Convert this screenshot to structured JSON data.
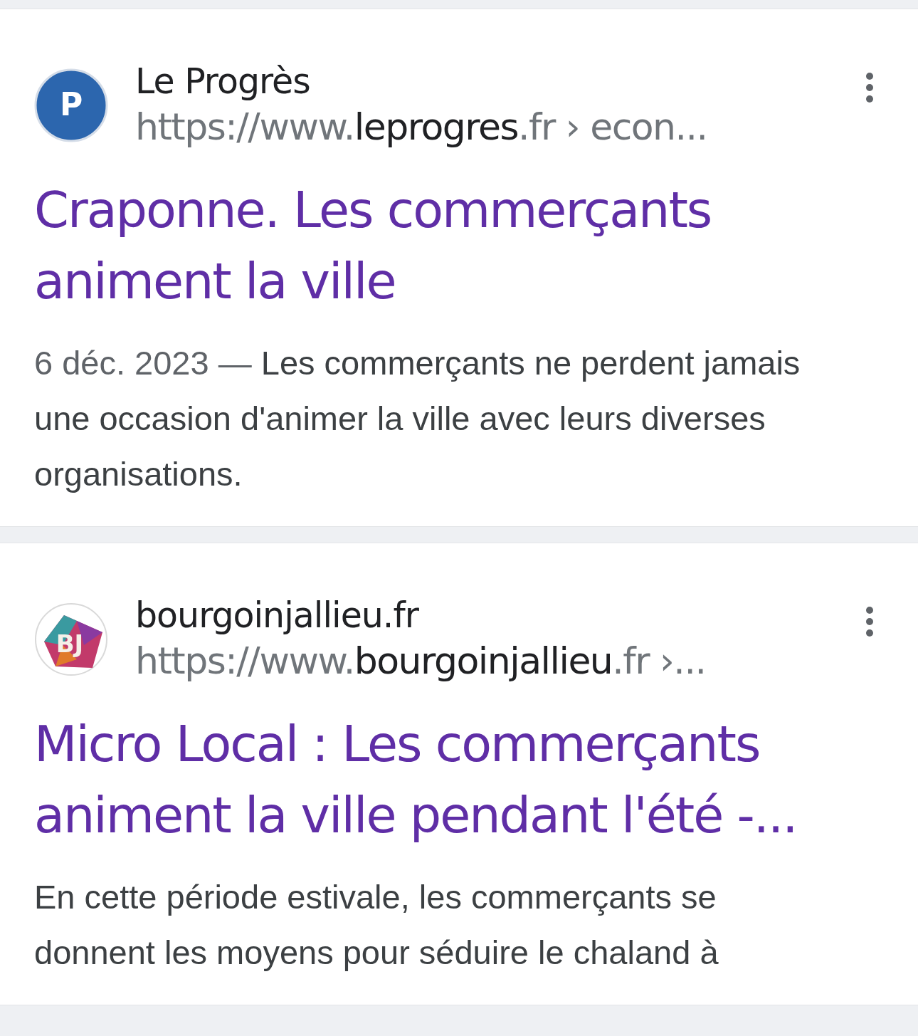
{
  "results": [
    {
      "source": "Le Progrès",
      "logo": {
        "kind": "letter",
        "text": "P"
      },
      "url_parts": [
        {
          "text": "https://www.",
          "strong": false
        },
        {
          "text": "leprogres",
          "strong": true
        },
        {
          "text": ".fr › econ...",
          "strong": false
        }
      ],
      "title": "Craponne. Les commerçants animent la ville",
      "date": "6 déc. 2023",
      "date_separator": "—",
      "snippet": "Les commerçants ne perdent jamais une occasion d'animer la ville avec leurs diverses organisations."
    },
    {
      "source": "bourgoinjallieu.fr",
      "logo": {
        "kind": "gem",
        "text": "BJ"
      },
      "url_parts": [
        {
          "text": "https://www.",
          "strong": false
        },
        {
          "text": "bourgoinjallieu",
          "strong": true
        },
        {
          "text": ".fr ›...",
          "strong": false
        }
      ],
      "title": "Micro Local : Les commerçants animent la ville pendant l'été -...",
      "snippet": "En cette période estivale, les commerçants se donnent les moyens pour séduire le chaland à"
    }
  ]
}
